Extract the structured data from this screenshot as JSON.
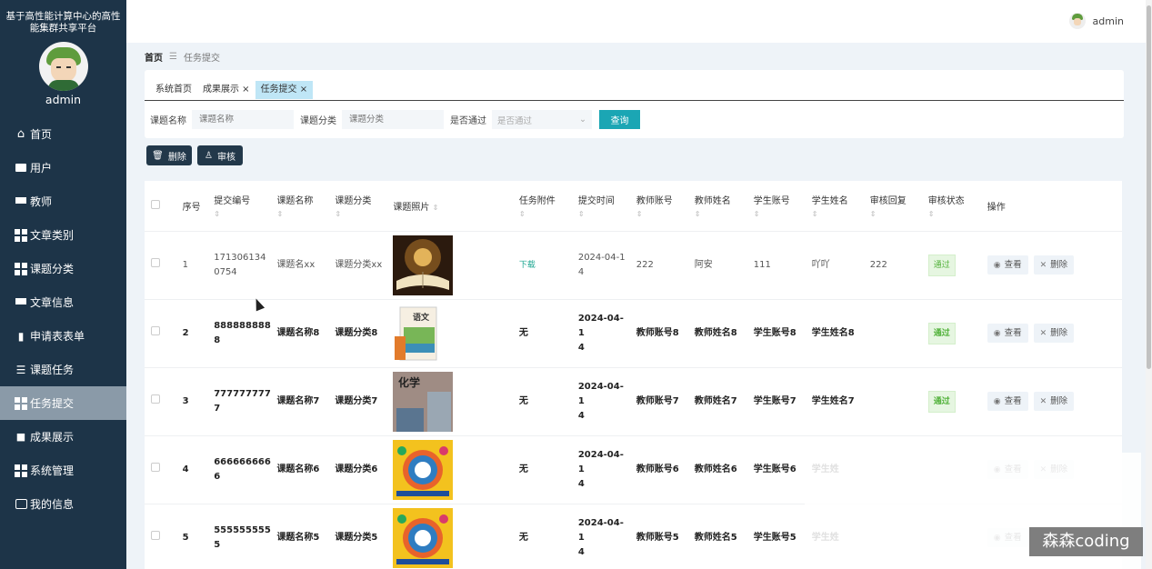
{
  "sidebar": {
    "title": "基于高性能计算中心的高性能集群共享平台",
    "username": "admin",
    "items": [
      {
        "label": "首页",
        "icon": "home-icon"
      },
      {
        "label": "用户",
        "icon": "briefcase-icon"
      },
      {
        "label": "教师",
        "icon": "monitor-icon"
      },
      {
        "label": "文章类别",
        "icon": "grid-icon"
      },
      {
        "label": "课题分类",
        "icon": "grid-icon"
      },
      {
        "label": "文章信息",
        "icon": "monitor-icon"
      },
      {
        "label": "申请表表单",
        "icon": "bar-chart-icon"
      },
      {
        "label": "课题任务",
        "icon": "sliders-icon"
      },
      {
        "label": "任务提交",
        "icon": "grid-icon",
        "active": true
      },
      {
        "label": "成果展示",
        "icon": "chat-icon"
      },
      {
        "label": "系统管理",
        "icon": "grid-icon"
      },
      {
        "label": "我的信息",
        "icon": "id-card-icon"
      }
    ]
  },
  "topbar": {
    "username": "admin"
  },
  "breadcrumb": {
    "home": "首页",
    "current": "任务提交"
  },
  "tabs": [
    {
      "label": "系统首页",
      "closable": false
    },
    {
      "label": "成果展示",
      "closable": true
    },
    {
      "label": "任务提交",
      "closable": true,
      "active": true
    }
  ],
  "filters": {
    "name_label": "课题名称",
    "name_placeholder": "课题名称",
    "category_label": "课题分类",
    "category_placeholder": "课题分类",
    "passed_label": "是否通过",
    "passed_placeholder": "是否通过",
    "query_label": "查询"
  },
  "actions": {
    "delete_label": "删除",
    "review_label": "审核"
  },
  "table": {
    "columns": [
      "序号",
      "提交编号",
      "课题名称",
      "课题分类",
      "课题照片",
      "任务附件",
      "提交时间",
      "教师账号",
      "教师姓名",
      "学生账号",
      "学生姓名",
      "审核回复",
      "审核状态",
      "操作"
    ],
    "view_label": "查看",
    "delete_label": "删除",
    "rows": [
      {
        "no": "1",
        "code_line1": "171306134",
        "code_line2": "0754",
        "name": "课题名xx",
        "category": "课题分类xx",
        "image": "golden-book-photo",
        "attachment": "下载",
        "time_line1": "2024-04-1",
        "time_line2": "4",
        "teacher_account": "222",
        "teacher_name": "阿安",
        "student_account": "111",
        "student_name": "吖吖",
        "reply": "222",
        "status": "通过"
      },
      {
        "no": "2",
        "code_line1": "888888888",
        "code_line2": "8",
        "name": "课题名称8",
        "category": "课题分类8",
        "image": "chinese-textbook-photo",
        "attachment": "无",
        "time_line1": "2024-04-1",
        "time_line2": "4",
        "teacher_account": "教师账号8",
        "teacher_name": "教师姓名8",
        "student_account": "学生账号8",
        "student_name": "学生姓名8",
        "reply": "",
        "status": "通过"
      },
      {
        "no": "3",
        "code_line1": "777777777",
        "code_line2": "7",
        "name": "课题名称7",
        "category": "课题分类7",
        "image": "chemistry-textbook-photo",
        "attachment": "无",
        "time_line1": "2024-04-1",
        "time_line2": "4",
        "teacher_account": "教师账号7",
        "teacher_name": "教师姓名7",
        "student_account": "学生账号7",
        "student_name": "学生姓名7",
        "reply": "",
        "status": "通过"
      },
      {
        "no": "4",
        "code_line1": "666666666",
        "code_line2": "6",
        "name": "课题名称6",
        "category": "课题分类6",
        "image": "colorful-diagram-photo",
        "attachment": "无",
        "time_line1": "2024-04-1",
        "time_line2": "4",
        "teacher_account": "教师账号6",
        "teacher_name": "教师姓名6",
        "student_account": "学生账号6",
        "student_name": "学生姓",
        "reply": "",
        "status": ""
      },
      {
        "no": "5",
        "code_line1": "555555555",
        "code_line2": "5",
        "name": "课题名称5",
        "category": "课题分类5",
        "image": "colorful-diagram-photo",
        "attachment": "无",
        "time_line1": "2024-04-1",
        "time_line2": "4",
        "teacher_account": "教师账号5",
        "teacher_name": "教师姓名5",
        "student_account": "学生账号5",
        "student_name": "学生姓",
        "reply": "",
        "status": ""
      }
    ]
  },
  "watermark": "森森coding",
  "colors": {
    "sidebar_bg": "#1d3448",
    "accent": "#1ba6b4",
    "active_tab": "#bfe6f6",
    "status_green": "#52b23b"
  }
}
